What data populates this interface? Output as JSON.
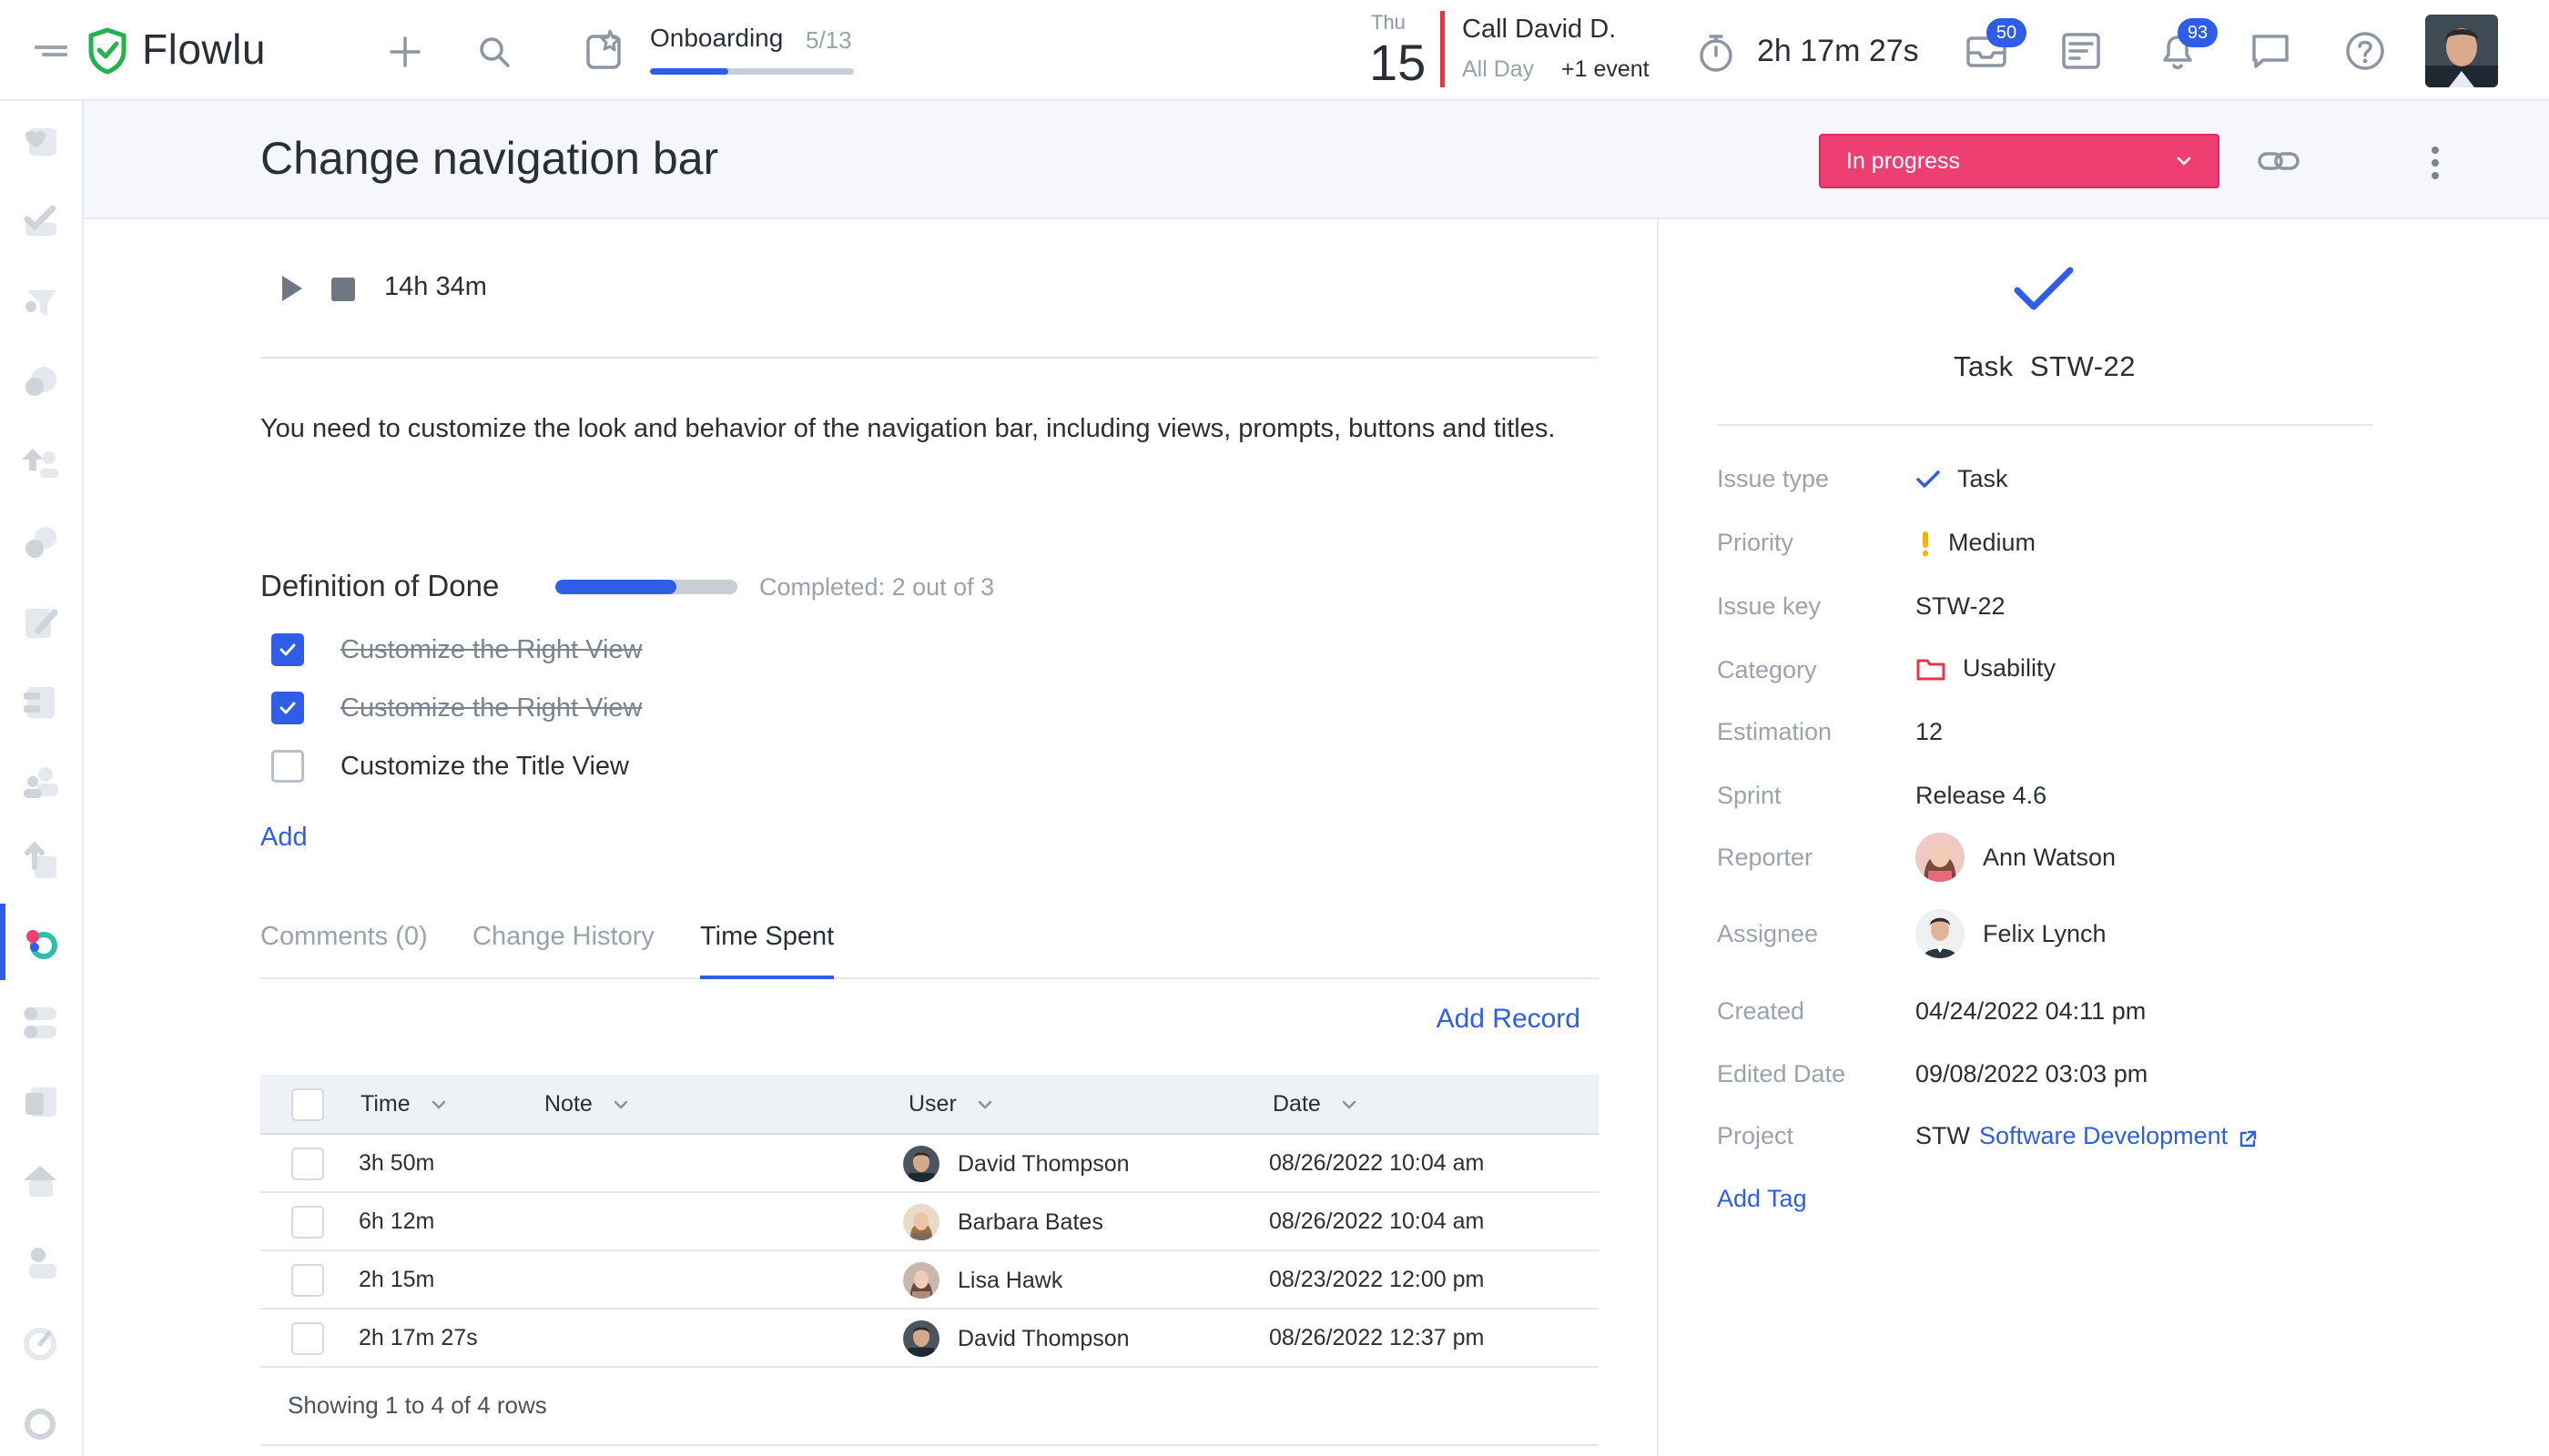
{
  "app": {
    "name": "Flowlu"
  },
  "topbar": {
    "onboarding": {
      "title": "Onboarding",
      "count": "5/13",
      "progress": 0.385
    },
    "calendar": {
      "weekday": "Thu",
      "day": "15",
      "event_title": "Call David D.",
      "event_when": "All Day",
      "event_more": "+1 event"
    },
    "timer": "2h 17m 27s",
    "badges": {
      "inbox": "50",
      "notifications": "93"
    }
  },
  "task": {
    "title": "Change navigation bar",
    "status": "In progress",
    "time_total": "14h 34m",
    "description": "You need to customize the look and behavior of the navigation bar, including views, prompts, buttons and titles.",
    "definition_of_done": {
      "title": "Definition of Done",
      "completed_text": "Completed: 2 out of 3",
      "progress": 0.667,
      "items": [
        {
          "label": "Customize the Right View",
          "done": true
        },
        {
          "label": "Customize the Right View",
          "done": true
        },
        {
          "label": "Customize the Title View",
          "done": false
        }
      ],
      "add_label": "Add"
    },
    "tabs": [
      {
        "label": "Comments (0)",
        "active": false
      },
      {
        "label": "Change History",
        "active": false
      },
      {
        "label": "Time Spent",
        "active": true
      }
    ],
    "add_record_label": "Add Record"
  },
  "time_table": {
    "columns": [
      "Time",
      "Note",
      "User",
      "Date"
    ],
    "rows": [
      {
        "time": "3h 50m",
        "note": "",
        "user": "David Thompson",
        "date": "08/26/2022 10:04 am"
      },
      {
        "time": "6h 12m",
        "note": "",
        "user": "Barbara Bates",
        "date": "08/26/2022 10:04 am"
      },
      {
        "time": "2h 15m",
        "note": "",
        "user": "Lisa Hawk",
        "date": "08/23/2022 12:00 pm"
      },
      {
        "time": "2h 17m 27s",
        "note": "",
        "user": "David Thompson",
        "date": "08/26/2022 12:37 pm"
      }
    ],
    "footer": "Showing 1 to 4 of 4 rows"
  },
  "side": {
    "type_label": "Task",
    "key": "STW-22",
    "properties": [
      {
        "label": "Issue type",
        "value": "Task"
      },
      {
        "label": "Priority",
        "value": "Medium"
      },
      {
        "label": "Issue key",
        "value": "STW-22"
      },
      {
        "label": "Category",
        "value": "Usability"
      },
      {
        "label": "Estimation",
        "value": "12"
      },
      {
        "label": "Sprint",
        "value": "Release 4.6"
      },
      {
        "label": "Reporter",
        "value": "Ann Watson"
      },
      {
        "label": "Assignee",
        "value": "Felix Lynch"
      },
      {
        "label": "Created",
        "value": "04/24/2022 04:11 pm"
      },
      {
        "label": "Edited Date",
        "value": "09/08/2022 03:03 pm"
      },
      {
        "label": "Project",
        "value": "STW",
        "link": "Software Development"
      }
    ],
    "add_tag_label": "Add Tag"
  },
  "colors": {
    "accent": "#2f5de8",
    "status": "#ee3f73",
    "priority": "#f2b705",
    "category": "#e2354b"
  }
}
